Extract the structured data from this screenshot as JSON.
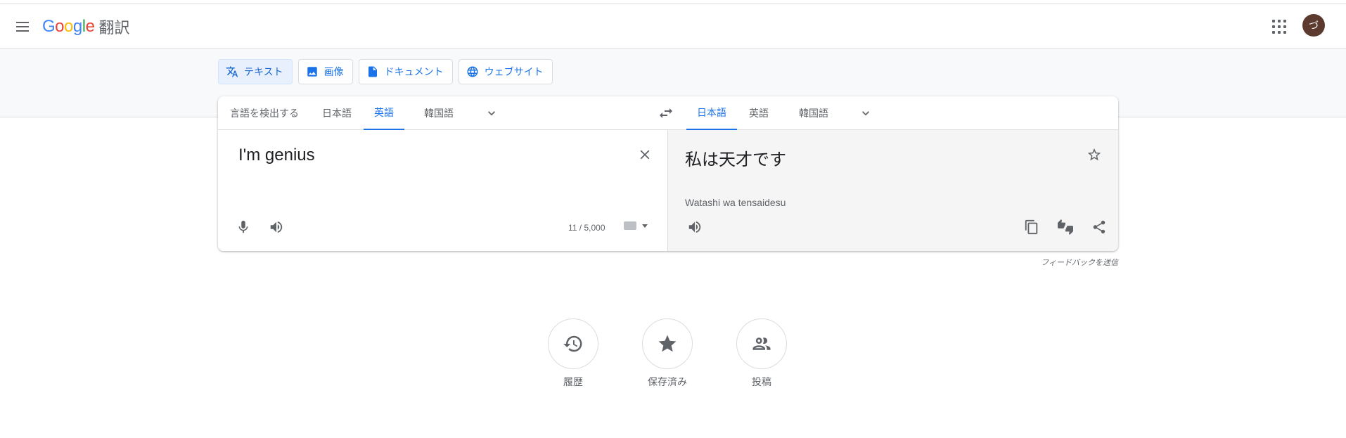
{
  "header": {
    "logo_letters": [
      "G",
      "o",
      "o",
      "g",
      "l",
      "e"
    ],
    "logo_colors": [
      "#4285f4",
      "#ea4335",
      "#fbbc05",
      "#4285f4",
      "#34a853",
      "#ea4335"
    ],
    "product_name": "翻訳",
    "avatar_initial": "づ",
    "avatar_color": "#5d3a2e"
  },
  "modes": [
    {
      "label": "テキスト",
      "icon": "translate-icon",
      "active": true
    },
    {
      "label": "画像",
      "icon": "image-icon",
      "active": false
    },
    {
      "label": "ドキュメント",
      "icon": "document-icon",
      "active": false
    },
    {
      "label": "ウェブサイト",
      "icon": "globe-icon",
      "active": false
    }
  ],
  "source_langs": [
    {
      "label": "言語を検出する",
      "active": false
    },
    {
      "label": "日本語",
      "active": false
    },
    {
      "label": "英語",
      "active": true
    },
    {
      "label": "韓国語",
      "active": false
    }
  ],
  "target_langs": [
    {
      "label": "日本語",
      "active": true
    },
    {
      "label": "英語",
      "active": false
    },
    {
      "label": "韓国語",
      "active": false
    }
  ],
  "source": {
    "text": "I'm genius",
    "char_count": "11 / 5,000"
  },
  "target": {
    "text": "私は天才です",
    "transliteration": "Watashi wa tensaidesu"
  },
  "feedback_link": "フィードバックを送信",
  "quick_actions": [
    {
      "label": "履歴",
      "icon": "history-icon"
    },
    {
      "label": "保存済み",
      "icon": "star-icon"
    },
    {
      "label": "投稿",
      "icon": "people-icon"
    }
  ],
  "colors": {
    "accent": "#1a73e8",
    "active_mode_bg": "#e8f0fe",
    "target_panel_bg": "#f5f5f5"
  }
}
